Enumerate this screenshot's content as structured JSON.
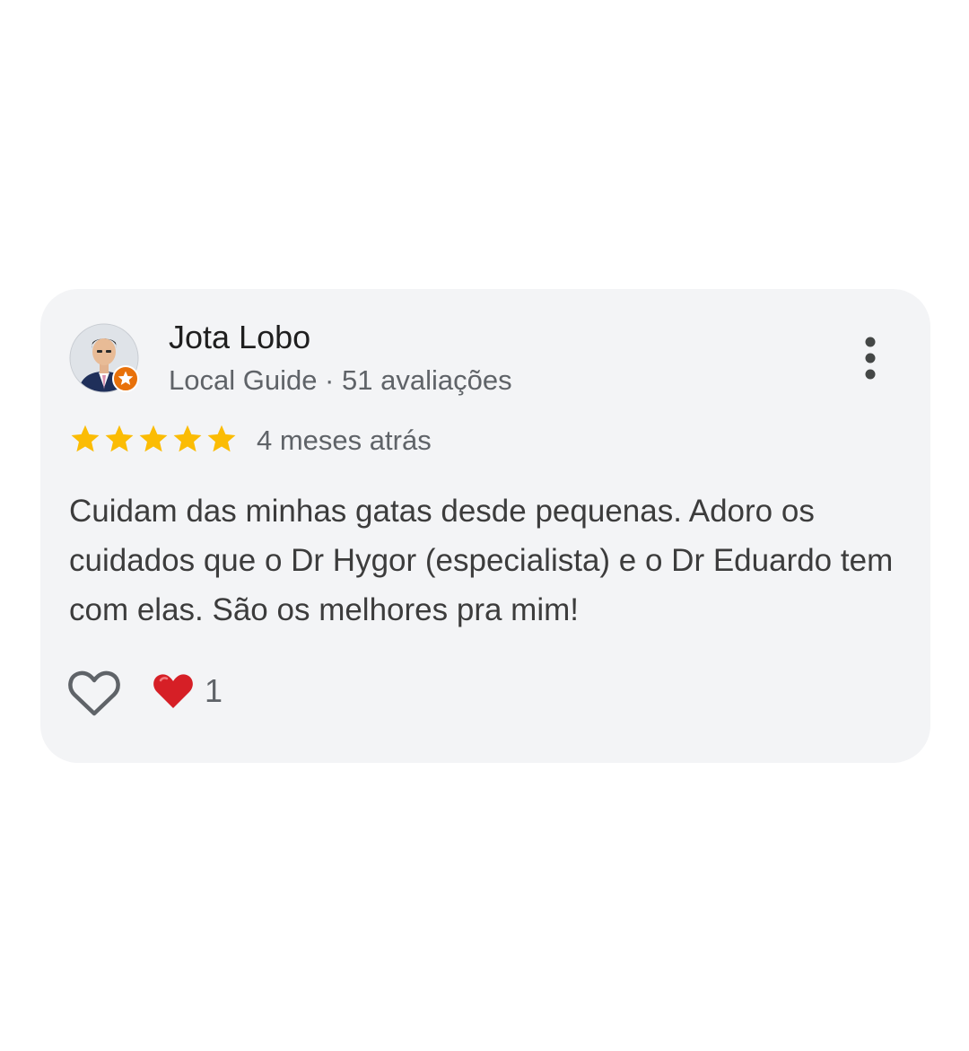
{
  "review": {
    "author": "Jota Lobo",
    "author_meta": "Local Guide · 51 avaliações",
    "rating": 5,
    "rating_max": 5,
    "time_ago": "4 meses atrás",
    "text": "Cuidam das minhas gatas desde pequenas. Adoro os cuidados que o Dr Hygor (especialista) e o Dr Eduardo tem com elas. São os melhores pra mim!",
    "reaction_count": "1"
  },
  "icons": {
    "avatar": "avatar",
    "badge": "local-guide-star-badge-icon",
    "more": "more-vert-icon",
    "star": "star-icon",
    "like": "heart-outline-icon",
    "reaction": "red-heart-icon"
  },
  "colors": {
    "card_bg": "#f3f4f6",
    "star": "#fbbc04",
    "badge": "#e8710a",
    "heart_red": "#d61f26",
    "text_primary": "#1f1f1f",
    "text_secondary": "#5f6368"
  }
}
